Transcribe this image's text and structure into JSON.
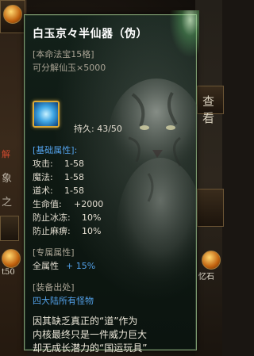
{
  "scene": {
    "left_texts": [
      "解",
      "象",
      "之",
      "i",
      "1"
    ],
    "left_bottom_label": "t50",
    "right_button_label": "查看",
    "right_bottom_label": "忆石"
  },
  "tooltip": {
    "title": "白玉京々半仙器（伪）",
    "subtitle_1": "[本命法宝15格]",
    "subtitle_2": "可分解仙玉×5000",
    "durability": "持久: 43/50",
    "base_header": "[基础属性]:",
    "base_stats": [
      {
        "label": "攻击:",
        "value": "1-58"
      },
      {
        "label": "魔法:",
        "value": "1-58"
      },
      {
        "label": "道术:",
        "value": "1-58"
      },
      {
        "label": "生命值:",
        "value": "+2000"
      },
      {
        "label": "防止冰冻:",
        "value": "10%"
      },
      {
        "label": "防止麻痹:",
        "value": "10%"
      }
    ],
    "exclusive_header": "[专属属性]",
    "exclusive_label": "全属性",
    "exclusive_value": "+ 15%",
    "source_header": "[装备出处]",
    "source_value": "四大陆所有怪物",
    "description": [
      "因其缺乏真正的“道”作为",
      "内核最终只是一件威力巨大",
      "却无成长潜力的“国运玩具”"
    ]
  },
  "colors": {
    "border": "#7d9b71",
    "title": "#ffffff",
    "header": "#52a0e8",
    "label_grey": "#a9a394",
    "text": "#e3ddd0"
  },
  "icons": {
    "item": "blue-crystal-orb-icon",
    "background": "tiger-illustration"
  }
}
